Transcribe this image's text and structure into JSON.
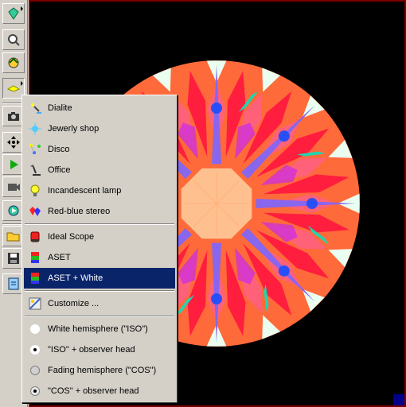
{
  "menu": {
    "items": [
      {
        "label": "Dialite",
        "icon": "lamp-sparkle-icon"
      },
      {
        "label": "Jewerly shop",
        "icon": "sparkle-lights-icon"
      },
      {
        "label": "Disco",
        "icon": "disco-lights-icon"
      },
      {
        "label": "Office",
        "icon": "desk-lamp-icon"
      },
      {
        "label": "Incandescent lamp",
        "icon": "light-bulb-icon"
      },
      {
        "label": "Red-blue stereo",
        "icon": "stereo-gem-icon"
      },
      {
        "label": "Ideal Scope",
        "icon": "scope-red-icon"
      },
      {
        "label": "ASET",
        "icon": "aset-icon"
      },
      {
        "label": "ASET + White",
        "icon": "aset-white-icon",
        "selected": true
      },
      {
        "label": "Customize ...",
        "icon": "customize-icon"
      },
      {
        "label": "White hemisphere (\"ISO\")",
        "icon": "radio-empty-icon"
      },
      {
        "label": "\"ISO\" + observer head",
        "icon": "radio-dot-icon"
      },
      {
        "label": "Fading hemisphere (\"COS\")",
        "icon": "radio-grey-icon"
      },
      {
        "label": "\"COS\" + observer head",
        "icon": "radio-dot-icon"
      }
    ]
  },
  "toolbar": {
    "buttons": [
      "gem-view-icon",
      "zoom-icon",
      "rotate-icon",
      "light-icon",
      "camera-icon",
      "move-icon",
      "play-icon",
      "record-icon",
      "animation-icon",
      "open-icon",
      "save-icon",
      "export-icon"
    ]
  },
  "colors": {
    "menu_highlight": "#0a246a",
    "viewport_border": "#7a0000",
    "gem_orange": "#ff6a3a",
    "gem_red": "#ff1040",
    "gem_violet": "#8866ee",
    "gem_center": "#ffc090"
  }
}
